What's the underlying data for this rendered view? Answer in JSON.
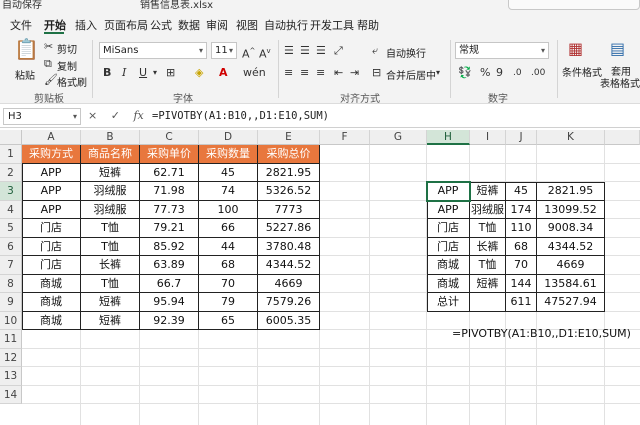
{
  "titlebar": {
    "autosave": "自动保存",
    "filename": "销售信息表.xlsx"
  },
  "tabs": [
    "文件",
    "开始",
    "插入",
    "页面布局",
    "公式",
    "数据",
    "审阅",
    "视图",
    "自动执行",
    "开发工具",
    "帮助"
  ],
  "active_tab": "开始",
  "ribbon": {
    "clipboard": {
      "paste": "粘贴",
      "cut": "剪切",
      "copy": "复制",
      "format_painter": "格式刷",
      "group": "剪贴板"
    },
    "font": {
      "name": "MiSans",
      "size": "11",
      "bold": "B",
      "italic": "I",
      "underline": "U",
      "group": "字体"
    },
    "alignment": {
      "wrap": "自动换行",
      "merge": "合并后居中",
      "group": "对齐方式"
    },
    "number": {
      "format": "常规",
      "group": "数字"
    },
    "styles": {
      "conditional": "条件格式",
      "table_format_1": "套用",
      "table_format_2": "表格格式"
    }
  },
  "formula_bar": {
    "name_box": "H3",
    "icons": [
      "×",
      "✓",
      "fx"
    ],
    "formula": "=PIVOTBY(A1:B10,,D1:E10,SUM)"
  },
  "columns": [
    "A",
    "B",
    "C",
    "D",
    "E",
    "F",
    "G",
    "H",
    "I",
    "J",
    "K"
  ],
  "rows": [
    "1",
    "2",
    "3",
    "4",
    "5",
    "6",
    "7",
    "8",
    "9",
    "10",
    "11",
    "12",
    "13",
    "14"
  ],
  "source_table": {
    "headers": [
      "采购方式",
      "商品名称",
      "采购单价",
      "采购数量",
      "采购总价"
    ],
    "rows": [
      [
        "APP",
        "短裤",
        "62.71",
        "45",
        "2821.95"
      ],
      [
        "APP",
        "羽绒服",
        "71.98",
        "74",
        "5326.52"
      ],
      [
        "APP",
        "羽绒服",
        "77.73",
        "100",
        "7773"
      ],
      [
        "门店",
        "T恤",
        "79.21",
        "66",
        "5227.86"
      ],
      [
        "门店",
        "T恤",
        "85.92",
        "44",
        "3780.48"
      ],
      [
        "门店",
        "长裤",
        "63.89",
        "68",
        "4344.52"
      ],
      [
        "商城",
        "T恤",
        "66.7",
        "70",
        "4669"
      ],
      [
        "商城",
        "短裤",
        "95.94",
        "79",
        "7579.26"
      ],
      [
        "商城",
        "短裤",
        "92.39",
        "65",
        "6005.35"
      ]
    ]
  },
  "pivot_table": {
    "rows": [
      [
        "APP",
        "短裤",
        "45",
        "2821.95"
      ],
      [
        "APP",
        "羽绒服",
        "174",
        "13099.52"
      ],
      [
        "门店",
        "T恤",
        "110",
        "9008.34"
      ],
      [
        "门店",
        "长裤",
        "68",
        "4344.52"
      ],
      [
        "商城",
        "T恤",
        "70",
        "4669"
      ],
      [
        "商城",
        "短裤",
        "144",
        "13584.61"
      ],
      [
        "总计",
        "",
        "611",
        "47527.94"
      ]
    ]
  },
  "formula_note": "=PIVOTBY(A1:B10,,D1:E10,SUM)",
  "colors": {
    "header_fill": "#e8773d",
    "accent": "#1e7145"
  }
}
